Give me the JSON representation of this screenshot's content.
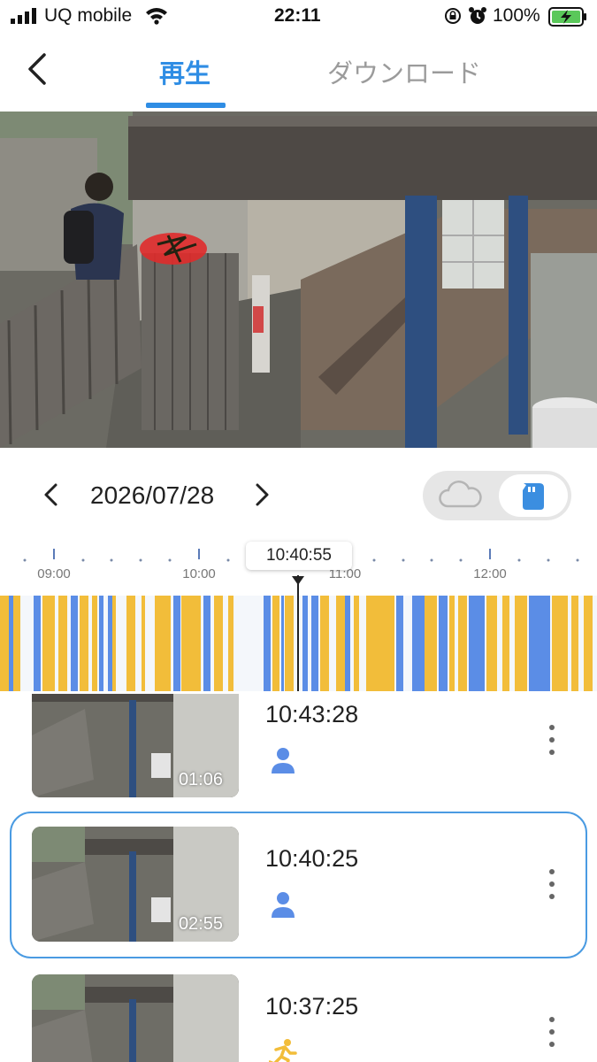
{
  "status_bar": {
    "carrier": "UQ mobile",
    "time": "22:11",
    "battery_percent": "100%"
  },
  "header": {
    "tabs": [
      {
        "label": "再生",
        "active": true
      },
      {
        "label": "ダウンロード",
        "active": false
      }
    ]
  },
  "date_nav": {
    "date": "2026/07/28",
    "storage_options": [
      {
        "icon": "cloud-icon",
        "selected": false
      },
      {
        "icon": "sd-card-icon",
        "selected": true
      }
    ]
  },
  "timeline": {
    "current_time": "10:40:55",
    "tick_labels": [
      "09:00",
      "10:00",
      "11:00",
      "12:00"
    ],
    "colors": {
      "person": "#5b8de6",
      "motion": "#f2bd3a",
      "background": "#f4f7fb"
    }
  },
  "clips": [
    {
      "time": "10:43:28",
      "duration": "01:06",
      "event": "person",
      "event_icon": "person-icon",
      "selected": false
    },
    {
      "time": "10:40:25",
      "duration": "02:55",
      "event": "person",
      "event_icon": "person-icon",
      "selected": true
    },
    {
      "time": "10:37:25",
      "duration": "",
      "event": "motion",
      "event_icon": "running-person-icon",
      "selected": false
    }
  ],
  "colors": {
    "accent": "#2f8de4",
    "person_event": "#5b8de6",
    "motion_event": "#f2bd3a",
    "selection_border": "#4a9be2"
  }
}
